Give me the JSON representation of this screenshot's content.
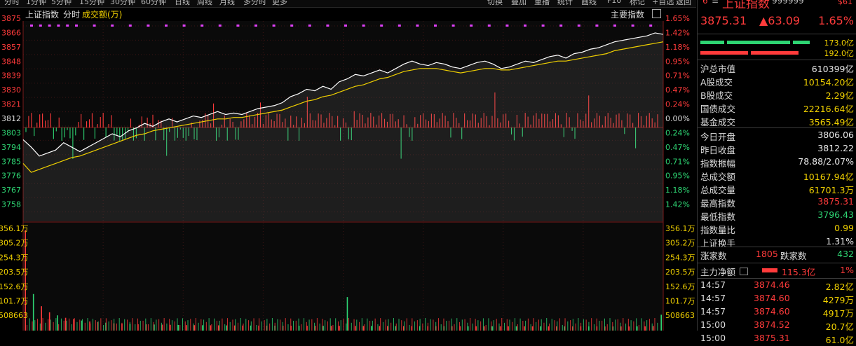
{
  "toolbar": {
    "periods": [
      "分时",
      "1分钟",
      "5分钟",
      "15分钟",
      "30分钟",
      "60分钟",
      "日线",
      "周线",
      "月线",
      "多分时",
      "更多"
    ],
    "actions": [
      "切换",
      "叠加",
      "重播",
      "统计",
      "画线",
      "F10",
      "标记",
      "+自选",
      "返回"
    ]
  },
  "legend": {
    "index_name": "上证指数",
    "mode": "分时",
    "volume_label": "成交额(万)",
    "main_index_label": "主要指数"
  },
  "price_axis": {
    "left": [
      "3875",
      "3866",
      "3857",
      "3848",
      "3839",
      "3830",
      "3821",
      "3812",
      "3803",
      "3794",
      "3785",
      "3776",
      "3767",
      "3758"
    ],
    "right_up": [
      "1.65%",
      "1.42%",
      "1.18%",
      "0.95%",
      "0.71%",
      "0.47%",
      "0.24%",
      "0.00%"
    ],
    "right_down": [
      "0.24%",
      "0.47%",
      "0.71%",
      "0.95%",
      "1.18%",
      "1.42%"
    ]
  },
  "volume_axis": {
    "left": [
      "356.1万",
      "305.2万",
      "254.3万",
      "203.5万",
      "152.6万",
      "101.7万",
      "508663"
    ],
    "right": [
      "356.1万",
      "305.2万",
      "254.3万",
      "203.5万",
      "152.6万",
      "101.7万",
      "508663"
    ]
  },
  "colors": {
    "up": "#ff3b3b",
    "down": "#2ed573",
    "price_line": "#ffffff",
    "avg_line": "#f0d000",
    "marker": "#e040fb"
  },
  "chart_data": {
    "type": "line",
    "title": "上证指数 分时",
    "prev_close": 3812.22,
    "ylim": [
      3749,
      3884
    ],
    "series": [
      {
        "name": "price",
        "values": [
          3804,
          3799,
          3793,
          3795,
          3797,
          3802,
          3799,
          3796,
          3799,
          3802,
          3805,
          3808,
          3806,
          3810,
          3812,
          3815,
          3813,
          3816,
          3818,
          3816,
          3818,
          3820,
          3819,
          3821,
          3823,
          3821,
          3822,
          3821,
          3823,
          3825,
          3826,
          3827,
          3829,
          3833,
          3835,
          3838,
          3837,
          3840,
          3838,
          3843,
          3845,
          3848,
          3847,
          3849,
          3851,
          3849,
          3852,
          3855,
          3857,
          3855,
          3854,
          3856,
          3855,
          3853,
          3852,
          3854,
          3856,
          3857,
          3855,
          3852,
          3853,
          3855,
          3857,
          3856,
          3858,
          3860,
          3861,
          3859,
          3862,
          3863,
          3865,
          3866,
          3868,
          3870,
          3871,
          3872,
          3873,
          3874,
          3876,
          3875
        ]
      },
      {
        "name": "average",
        "values": [
          3788,
          3782,
          3784,
          3786,
          3788,
          3790,
          3792,
          3793,
          3795,
          3797,
          3799,
          3801,
          3803,
          3805,
          3807,
          3808,
          3810,
          3811,
          3812,
          3813,
          3814,
          3815,
          3816,
          3817,
          3818,
          3818,
          3819,
          3819,
          3820,
          3821,
          3822,
          3823,
          3824,
          3826,
          3828,
          3830,
          3831,
          3833,
          3834,
          3836,
          3838,
          3840,
          3841,
          3843,
          3845,
          3846,
          3848,
          3850,
          3851,
          3852,
          3852,
          3852,
          3851,
          3850,
          3849,
          3850,
          3851,
          3852,
          3852,
          3851,
          3851,
          3852,
          3853,
          3854,
          3855,
          3856,
          3857,
          3857,
          3858,
          3859,
          3860,
          3861,
          3862,
          3864,
          3865,
          3866,
          3867,
          3868,
          3869,
          3870
        ]
      }
    ],
    "volume_ylim": [
      0,
      3561000
    ],
    "volume_values": [
      3300000,
      1200000,
      800000,
      600000,
      500000,
      420000,
      380000,
      330000,
      300000,
      280000,
      260000,
      240000,
      230000,
      220000,
      210000,
      205000,
      200000,
      195000,
      190000,
      185000,
      180000,
      178000,
      176000,
      174000,
      172000,
      170000,
      168000,
      166000,
      165000,
      164000,
      163000,
      162000,
      161000,
      160000,
      159000,
      158000,
      157000,
      156000,
      155000,
      154000,
      1100000,
      153000,
      152000,
      151000,
      150000,
      150000,
      149000,
      148000,
      147000,
      146000,
      146000,
      145000,
      145000,
      144000,
      144000,
      143000,
      143000,
      142000,
      142000,
      141000,
      141000,
      140000,
      140000,
      139000,
      139000,
      139000,
      138000,
      138000,
      138000,
      137000,
      137000,
      137000,
      136000,
      136000,
      136000,
      135000,
      138000,
      140000,
      150000,
      520000
    ]
  },
  "quote": {
    "symbol": "6",
    "name": "上证指数",
    "code": "999999",
    "tag": "$61",
    "last": "3875.31",
    "change": "▲63.09",
    "pct": "1.65%",
    "bar_top": "173.0亿",
    "bar_bottom": "192.0亿"
  },
  "market": [
    {
      "k": "沪总市值",
      "v": "610399亿",
      "c": "white"
    },
    {
      "k": "A股成交",
      "v": "10154.20亿",
      "c": "yellow"
    },
    {
      "k": "B股成交",
      "v": "2.29亿",
      "c": "yellow"
    },
    {
      "k": "国债成交",
      "v": "22216.64亿",
      "c": "yellow"
    },
    {
      "k": "基金成交",
      "v": "3565.49亿",
      "c": "yellow"
    }
  ],
  "stats": [
    {
      "k": "今日开盘",
      "v": "3806.06",
      "c": "white"
    },
    {
      "k": "昨日收盘",
      "v": "3812.22",
      "c": "white"
    },
    {
      "k": "指数振幅",
      "v": "78.88/2.07%",
      "c": "white"
    },
    {
      "k": "总成交额",
      "v": "10167.94亿",
      "c": "yellow"
    },
    {
      "k": "总成交量",
      "v": "61701.3万",
      "c": "yellow"
    },
    {
      "k": "最高指数",
      "v": "3875.31",
      "c": "red"
    },
    {
      "k": "最低指数",
      "v": "3796.43",
      "c": "green"
    },
    {
      "k": "指数量比",
      "v": "0.99",
      "c": "yellow"
    },
    {
      "k": "上证换手",
      "v": "1.31%",
      "c": "white"
    }
  ],
  "breadth": {
    "up_label": "涨家数",
    "up": "1805",
    "down_label": "跌家数",
    "down": "432"
  },
  "mainflow": {
    "label": "主力净额",
    "value": "115.3亿",
    "pct": "1%"
  },
  "ticks": [
    {
      "t": "14:57",
      "p": "3874.46",
      "v": "2.82亿"
    },
    {
      "t": "14:57",
      "p": "3874.60",
      "v": "4279万"
    },
    {
      "t": "14:57",
      "p": "3874.60",
      "v": "4917万"
    },
    {
      "t": "15:00",
      "p": "3874.52",
      "v": "20.7亿"
    },
    {
      "t": "15:00",
      "p": "3875.31",
      "v": "61.0亿"
    }
  ]
}
